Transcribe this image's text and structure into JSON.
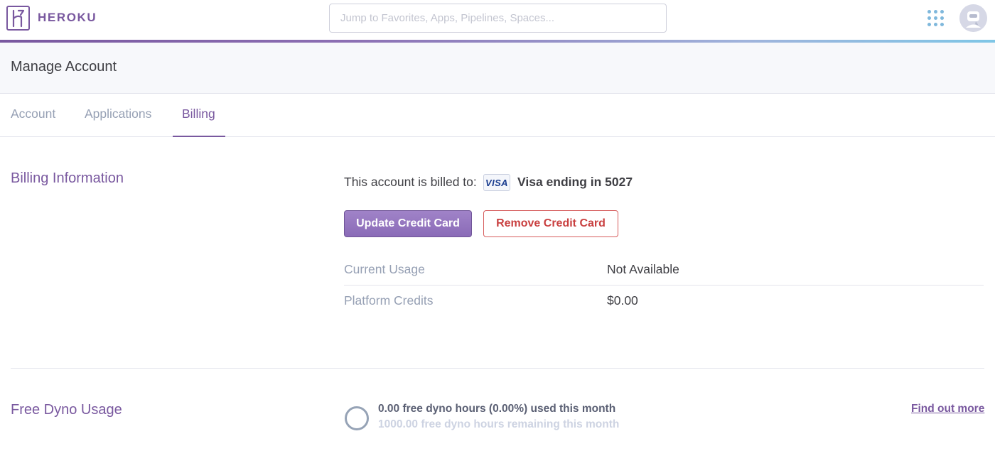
{
  "header": {
    "brand": "HEROKU",
    "search": {
      "placeholder": "Jump to Favorites, Apps, Pipelines, Spaces...",
      "value": ""
    },
    "icons": [
      "heroku-logo-icon",
      "apps-grid-icon",
      "user-avatar"
    ]
  },
  "page": {
    "title": "Manage Account"
  },
  "tabs": [
    {
      "label": "Account",
      "active": false
    },
    {
      "label": "Applications",
      "active": false
    },
    {
      "label": "Billing",
      "active": true
    }
  ],
  "billing": {
    "section_title": "Billing Information",
    "billed_to_prefix": "This account is billed to:",
    "card_brand": "VISA",
    "card_description": "Visa ending in 5027",
    "update_button": "Update Credit Card",
    "remove_button": "Remove Credit Card",
    "rows": [
      {
        "label": "Current Usage",
        "value": "Not Available"
      },
      {
        "label": "Platform Credits",
        "value": "$0.00"
      }
    ]
  },
  "dyno": {
    "section_title": "Free Dyno Usage",
    "used_text": "0.00 free dyno hours (0.00%) used this month",
    "remaining_text": "1000.00 free dyno hours remaining this month",
    "used_fraction": 0.0,
    "link": "Find out more"
  },
  "colors": {
    "brand_purple": "#79589f",
    "danger_red": "#c94040",
    "muted_text": "#96a0b4"
  }
}
